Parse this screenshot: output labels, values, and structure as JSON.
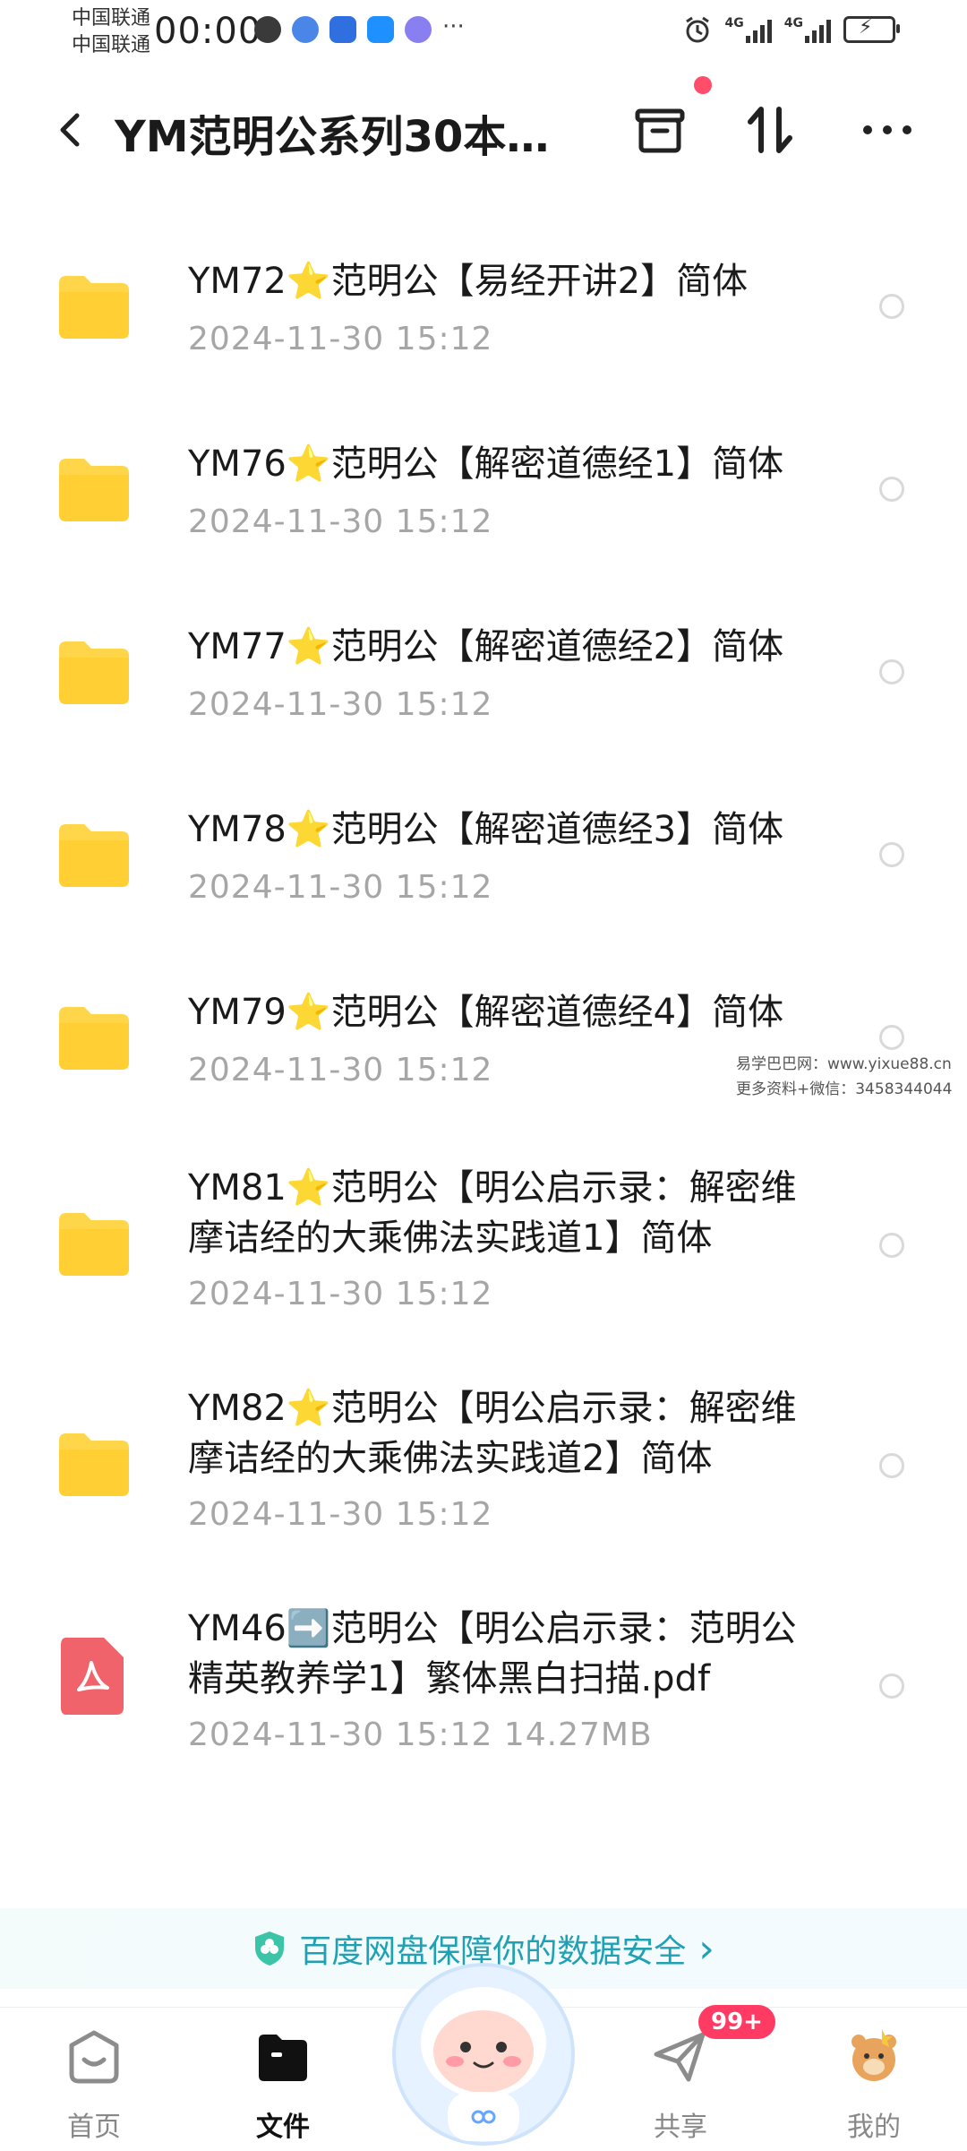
{
  "status_bar": {
    "carrier_1": "中国联通",
    "carrier_2": "中国联通",
    "time": "00:00",
    "more": "···",
    "net_1": "4G",
    "net_2": "4G"
  },
  "header": {
    "title": "YM范明公系列30本…",
    "icons": [
      "back-icon",
      "trash-box-icon",
      "sort-icon",
      "more-icon"
    ]
  },
  "files": [
    {
      "name": "YM72⭐范明公【易经开讲2】简体",
      "meta": "2024-11-30  15:12",
      "type": "folder"
    },
    {
      "name": "YM76⭐范明公【解密道德经1】简体",
      "meta": "2024-11-30  15:12",
      "type": "folder"
    },
    {
      "name": "YM77⭐范明公【解密道德经2】简体",
      "meta": "2024-11-30  15:12",
      "type": "folder"
    },
    {
      "name": "YM78⭐范明公【解密道德经3】简体",
      "meta": "2024-11-30  15:12",
      "type": "folder"
    },
    {
      "name": "YM79⭐范明公【解密道德经4】简体",
      "meta": "2024-11-30  15:12",
      "type": "folder"
    },
    {
      "name": "YM81⭐范明公【明公启示录：解密维摩诘经的大乘佛法实践道1】简体",
      "meta": "2024-11-30  15:12",
      "type": "folder"
    },
    {
      "name": "YM82⭐范明公【明公启示录：解密维摩诘经的大乘佛法实践道2】简体",
      "meta": "2024-11-30  15:12",
      "type": "folder"
    },
    {
      "name": "YM46➡️范明公【明公启示录：范明公精英教养学1】繁体黑白扫描.pdf",
      "meta": "2024-11-30  15:12  14.27MB",
      "type": "pdf"
    }
  ],
  "watermark": {
    "line1": "易学巴巴网：www.yixue88.cn",
    "line2": "更多资料+微信：3458344044"
  },
  "safety_banner": {
    "text": "百度网盘保障你的数据安全",
    "arrow": "›"
  },
  "bottom_nav": {
    "items": [
      {
        "label": "首页",
        "icon": "home-icon"
      },
      {
        "label": "文件",
        "icon": "folder-tab-icon"
      },
      {
        "label": "",
        "icon": "mascot-icon"
      },
      {
        "label": "共享",
        "icon": "share-plane-icon"
      },
      {
        "label": "我的",
        "icon": "profile-avatar-icon"
      }
    ],
    "badge": "99+"
  },
  "colors": {
    "folder": "#ffd54a",
    "pdf": "#f1636b",
    "accent": "#1fa1b3",
    "badge": "#ff3b63"
  }
}
